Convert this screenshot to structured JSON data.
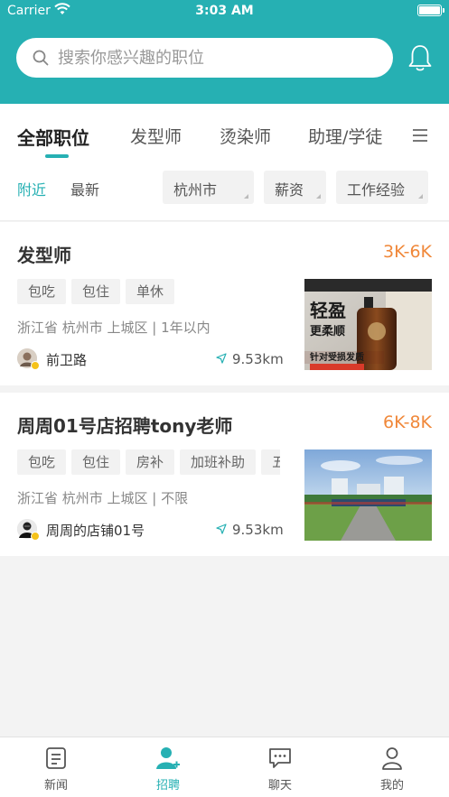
{
  "status": {
    "carrier": "Carrier",
    "time": "3:03 AM",
    "battery_level": 1.0
  },
  "search": {
    "placeholder": "搜索你感兴趣的职位",
    "value": ""
  },
  "tabs": [
    {
      "label": "全部职位",
      "active": true
    },
    {
      "label": "发型师",
      "active": false
    },
    {
      "label": "烫染师",
      "active": false
    },
    {
      "label": "助理/学徒",
      "active": false
    }
  ],
  "filters": {
    "nearby": "附近",
    "latest": "最新",
    "city": "杭州市",
    "salary": "薪资",
    "experience": "工作经验"
  },
  "jobs": [
    {
      "title": "发型师",
      "salary": "3K-6K",
      "tags": [
        "包吃",
        "包住",
        "单休"
      ],
      "location": "浙江省 杭州市 上城区  |  1年以内",
      "shop": "前卫路",
      "distance": "9.53km",
      "image_text": {
        "big": "轻盈",
        "sub": "更柔顺",
        "tagline": "针对受损发质"
      }
    },
    {
      "title": "周周01号店招聘tony老师",
      "salary": "6K-8K",
      "tags": [
        "包吃",
        "包住",
        "房补",
        "加班补助",
        "五"
      ],
      "location": "浙江省 杭州市 上城区  |  不限",
      "shop": "周周的店铺01号",
      "distance": "9.53km"
    }
  ],
  "nav": [
    {
      "label": "新闻",
      "icon": "news-icon"
    },
    {
      "label": "招聘",
      "icon": "recruit-icon",
      "active": true
    },
    {
      "label": "聊天",
      "icon": "chat-icon"
    },
    {
      "label": "我的",
      "icon": "profile-icon"
    }
  ],
  "colors": {
    "accent": "#26b0b3",
    "salary": "#f0883a",
    "badge": "#f5c21a"
  }
}
